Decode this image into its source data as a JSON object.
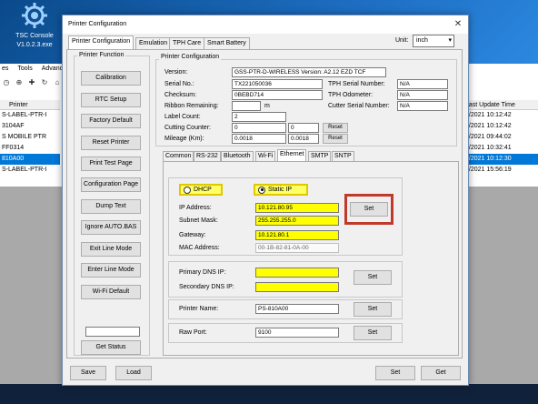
{
  "desktop_icon": {
    "label_line1": "TSC Console",
    "label_line2": "V1.0.2.3.exe"
  },
  "background_app": {
    "menu": [
      "es",
      "Tools",
      "Advance"
    ],
    "list_header_left": "Printer",
    "list_header_right": "Last Update Time",
    "rows": [
      {
        "printer": "S-LABEL-PTR-I",
        "time": "7/2021 10:12:42"
      },
      {
        "printer": "3104AF",
        "time": "7/2021 10:12:42"
      },
      {
        "printer": "S MOBILE PTR",
        "time": "6/2021 09:44:02"
      },
      {
        "printer": "FF0314",
        "time": "7/2021 10:32:41"
      },
      {
        "printer": "810A00",
        "time": "7/2021 10:12:30"
      },
      {
        "printer": "S-LABEL-PTR-I",
        "time": "6/2021 15:56:19"
      }
    ]
  },
  "dialog": {
    "title": "Printer Configuration",
    "close": "✕",
    "tabs": [
      "Printer Configuration",
      "Emulation",
      "TPH Care",
      "Smart Battery"
    ],
    "unit_label": "Unit:",
    "unit_value": "inch",
    "printer_function": {
      "title": "Printer Function",
      "buttons": [
        "Calibration",
        "RTC Setup",
        "Factory Default",
        "Reset Printer",
        "Print Test Page",
        "Configuration Page",
        "Dump Text",
        "Ignore AUTO.BAS",
        "Exit Line Mode",
        "Enter Line Mode",
        "Wi-Fi Default"
      ],
      "status_value": "",
      "get_status": "Get Status"
    },
    "printer_configuration": {
      "title": "Printer Configuration",
      "version_label": "Version:",
      "version_value": "GSS-PTR-D-WIRELESS Version: A2.12 EZD TCF",
      "serial_label": "Serial No.:",
      "serial_value": "TX221050036",
      "checksum_label": "Checksum:",
      "checksum_value": "0BEBD714",
      "ribbon_label": "Ribbon Remaining:",
      "ribbon_value": "",
      "ribbon_unit": "m",
      "label_count_label": "Label Count:",
      "label_count_value": "2",
      "cutting_label": "Cutting Counter:",
      "cutting_value1": "0",
      "cutting_value2": "0",
      "mileage_label": "Mileage (Km):",
      "mileage_value1": "0.0018",
      "mileage_value2": "0.0018",
      "reset_label": "Reset",
      "tph_serial_label": "TPH Serial Number:",
      "tph_serial_value": "N/A",
      "tph_odometer_label": "TPH Odometer:",
      "tph_odometer_value": "N/A",
      "cutter_serial_label": "Cutter Serial Number:",
      "cutter_serial_value": "N/A"
    },
    "sub_tabs": [
      "Common",
      "RS-232",
      "Bluetooth",
      "Wi-Fi",
      "Ethernet",
      "SMTP",
      "SNTP"
    ],
    "ethernet": {
      "dhcp_label": "DHCP",
      "static_ip_label": "Static IP",
      "ip_label": "IP Address:",
      "ip_value": "10.121.80.95",
      "subnet_label": "Subnet Mask:",
      "subnet_value": "255.255.255.0",
      "gateway_label": "Gateway:",
      "gateway_value": "10.121.80.1",
      "mac_label": "MAC Address:",
      "mac_value": "00-1B-82-81-0A-00",
      "primary_dns_label": "Primary DNS IP:",
      "primary_dns_value": "",
      "secondary_dns_label": "Secondary DNS IP:",
      "secondary_dns_value": "",
      "printer_name_label": "Printer Name:",
      "printer_name_value": "PS-810A00",
      "raw_port_label": "Raw Port:",
      "raw_port_value": "9100",
      "set_label": "Set"
    },
    "footer": {
      "save": "Save",
      "load": "Load",
      "set": "Set",
      "get": "Get"
    },
    "colors": {
      "highlight": "#ffff00",
      "callout": "#c0392b"
    }
  }
}
